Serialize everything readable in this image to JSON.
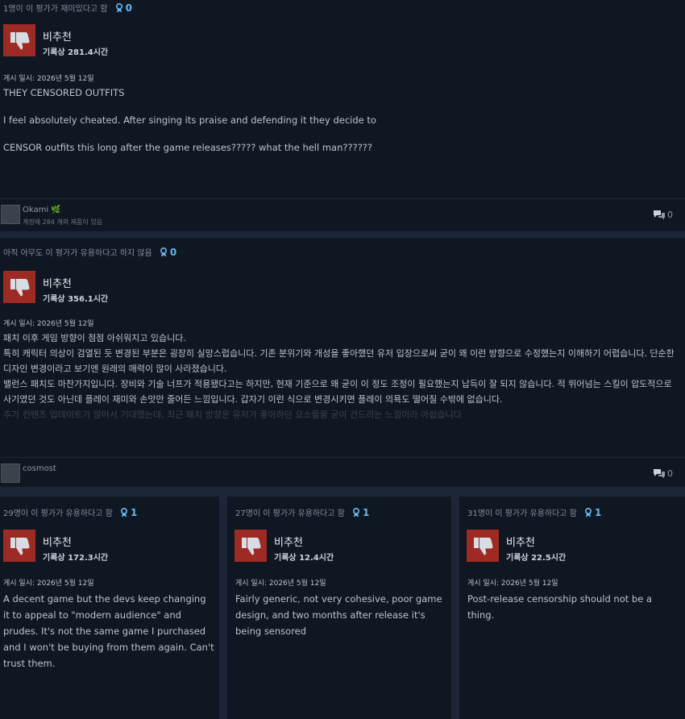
{
  "colors": {
    "page_bg": "#1b2636",
    "card_bg": "#0f1722",
    "thumb_bg": "#9e2a24",
    "award_blue": "#66b8f0"
  },
  "icons": {
    "thumb": "thumbs-down-icon",
    "award": "award-ribbon-icon",
    "comment": "comment-bubble-icon"
  },
  "review1": {
    "helpful": "1명이 이 평가가 재미있다고 함",
    "award_count": "0",
    "verdict": "비추천",
    "hours": "기록상 281.4시간",
    "date": "게시 일시: 2026년 5월 12일",
    "lines": [
      "THEY CENSORED OUTFITS",
      "I feel absolutely cheated. After singing its praise and defending it they decide to",
      "CENSOR outfits this long after the game releases????? what the hell man??????"
    ],
    "user": "Okami 🌿",
    "user_sub": "계정에 284 개의 제품이 있음",
    "comments": "0"
  },
  "review2": {
    "helpful": "아직 아무도 이 평가가 유용하다고 하지 않음",
    "award_count": "0",
    "verdict": "비추천",
    "hours": "기록상 356.1시간",
    "date": "게시 일시: 2026년 5월 12일",
    "lines": [
      "패치 이후 게임 방향이 점점 아쉬워지고 있습니다.",
      "특히 캐릭터 의상이 검열된 듯 변경된 부분은 굉장히 실망스럽습니다. 기존 분위기와 개성을 좋아했던 유저 입장으로써 굳이 왜 이런 방향으로 수정했는지 이해하기 어렵습니다. 단순한 디자인 변경이라고 보기엔 원래의 매력이 많이 사라졌습니다.",
      "밸런스 패치도 마찬가지입니다. 장비와 기술 너프가 적용됐다고는 하지만, 현재 기준으로 왜 굳이 이 정도 조정이 필요했는지 납득이 잘 되지 않습니다. 적 뛰어넘는 스킬이 압도적으로 사기였던 것도 아닌데 플레이 재미와 손맛만 줄어든 느낌입니다. 갑자기 이런 식으로 변경시키면 플레이 의욕도 떨어질 수밖에 없습니다.",
      "추가 컨텐츠 업데이트가 많아서 기대했는데, 최근 패치 방향은 유저가 좋아하던 요소들을 굳이 건드리는 느낌이라 아쉽습니다"
    ],
    "user": "cosmost",
    "comments": "0"
  },
  "review3": {
    "helpful": "29명이 이 평가가 유용하다고 함",
    "award_count": "1",
    "verdict": "비추천",
    "hours": "기록상 172.3시간",
    "date": "게시 일시: 2026년 5월 12일",
    "body": "A decent game but the devs keep changing it to appeal to \"modern audience\" and prudes. It's not the same game I purchased and I won't be buying from them again. Can't trust them."
  },
  "review4": {
    "helpful": "27명이 이 평가가 유용하다고 함",
    "award_count": "1",
    "verdict": "비추천",
    "hours": "기록상 12.4시간",
    "date": "게시 일시: 2026년 5월 12일",
    "body": "Fairly generic, not very cohesive, poor game design, and two months after release it's being sensored"
  },
  "review5": {
    "helpful": "31명이 이 평가가 유용하다고 함",
    "award_count": "1",
    "verdict": "비추천",
    "hours": "기록상 22.5시간",
    "date": "게시 일시: 2026년 5월 12일",
    "body": "Post-release censorship should not be a thing."
  }
}
